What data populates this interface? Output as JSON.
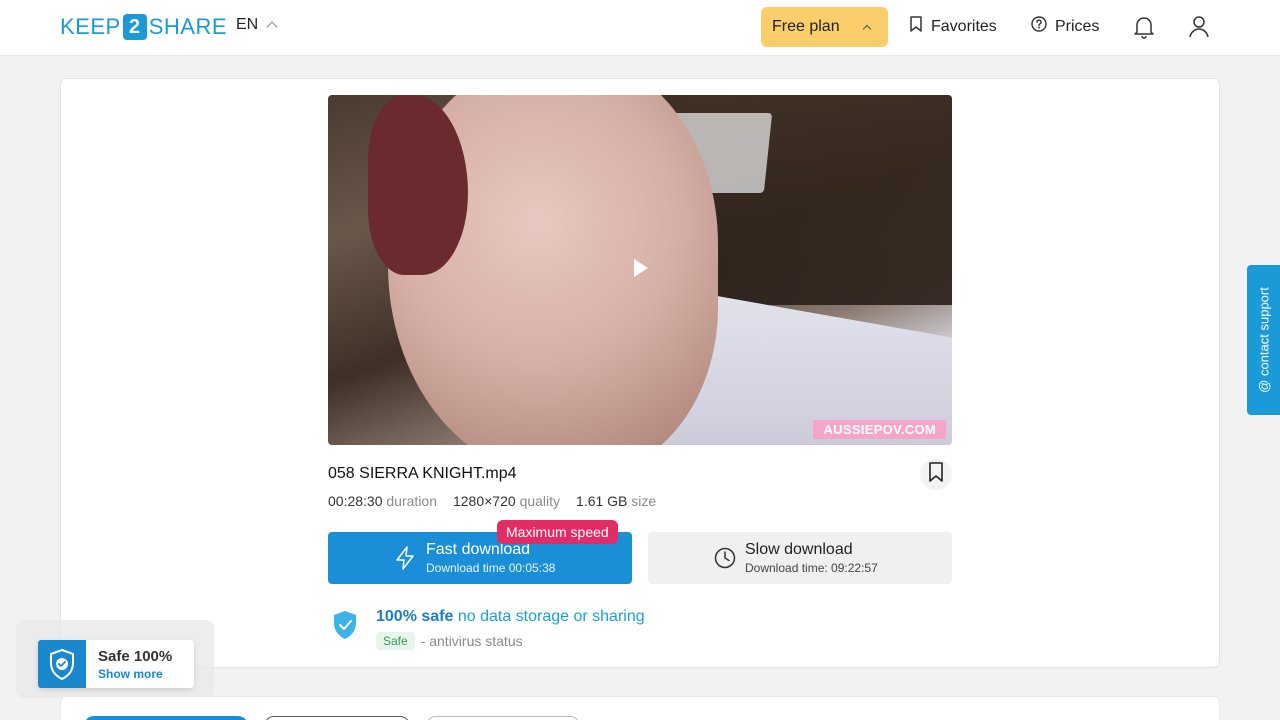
{
  "header": {
    "logo_left": "KEEP",
    "logo_mid": "2",
    "logo_right": "SHARE",
    "language": "EN",
    "plan": "Free plan",
    "favorites": "Favorites",
    "prices": "Prices",
    "icons": [
      "bookmark-icon",
      "help-circle-icon",
      "bell-icon",
      "user-icon"
    ]
  },
  "video": {
    "watermark": "AUSSIEPOV.COM",
    "icon": "play-icon"
  },
  "file": {
    "name": "058 SIERRA KNIGHT.mp4",
    "duration": "00:28:30",
    "duration_label": "duration",
    "quality": "1280×720",
    "quality_label": "quality",
    "size": "1.61 GB",
    "size_label": "size"
  },
  "downloads": {
    "fast_label": "Fast download",
    "fast_time": "Download time 00:05:38",
    "fast_badge": "Maximum speed",
    "slow_label": "Slow download",
    "slow_time": "Download time: 09:22:57"
  },
  "safety": {
    "strong": "100% safe",
    "rest": "no data storage or sharing",
    "badge": "Safe",
    "status": "- antivirus status"
  },
  "support": {
    "label": "@ contact support"
  },
  "safe_widget": {
    "title": "Safe 100%",
    "link": "Show more"
  },
  "colors": {
    "brand": "#1a9ad6",
    "plan_bg": "#fbcd6b",
    "fast_bg": "#1a8fd8",
    "badge_bg": "#e02d63"
  }
}
